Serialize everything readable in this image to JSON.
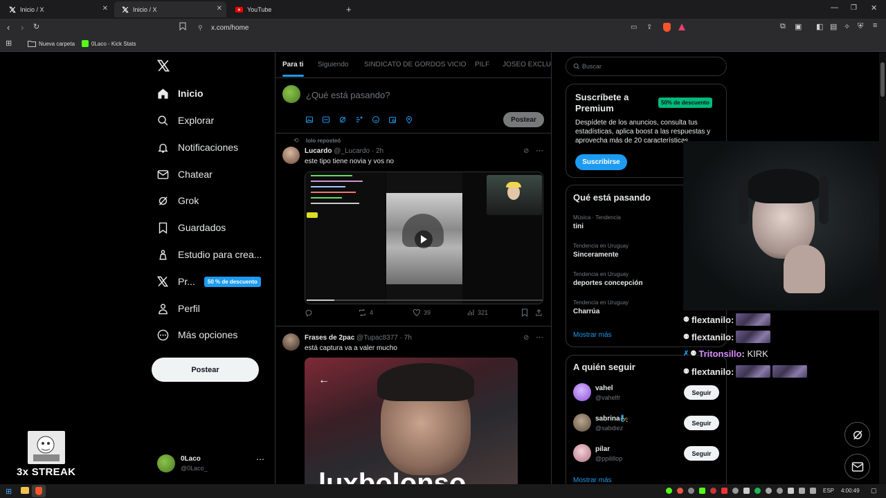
{
  "browser": {
    "tabs": [
      {
        "title": "Inicio / X"
      },
      {
        "title": "Inicio / X"
      },
      {
        "title": "YouTube"
      }
    ],
    "url": "x.com/home",
    "bookmarks": [
      {
        "label": "Nueva carpeta",
        "icon": "folder-icon"
      },
      {
        "label": "0Laco - Kick Stats",
        "icon": "kick-icon"
      }
    ]
  },
  "sidebar": {
    "nav": [
      {
        "label": "Inicio",
        "icon": "home-icon",
        "active": true
      },
      {
        "label": "Explorar",
        "icon": "search-icon"
      },
      {
        "label": "Notificaciones",
        "icon": "bell-icon"
      },
      {
        "label": "Chatear",
        "icon": "mail-icon"
      },
      {
        "label": "Grok",
        "icon": "grok-icon"
      },
      {
        "label": "Guardados",
        "icon": "bookmark-icon"
      },
      {
        "label": "Estudio para crea...",
        "icon": "studio-icon"
      },
      {
        "label": "Pr...",
        "icon": "x-premium-icon",
        "badge": "50 % de descuento"
      },
      {
        "label": "Perfil",
        "icon": "person-icon"
      },
      {
        "label": "Más opciones",
        "icon": "more-circle-icon"
      }
    ],
    "post_button": "Postear",
    "account": {
      "name": "0Laco",
      "handle": "@0Laco_"
    }
  },
  "feed": {
    "tabs": [
      "Para ti",
      "Siguiendo",
      "SINDICATO DE GORDOS VICIO",
      "PILF",
      "JOSEO EXCLUSI"
    ],
    "composer": {
      "placeholder": "¿Qué está pasando?",
      "post_button": "Postear"
    },
    "posts": [
      {
        "repost_note": "lolo reposteó",
        "author": "Lucardo",
        "handle": "@_Lucardo",
        "time": "2h",
        "text": "este tipo tiene novia y vos no",
        "replies": "",
        "reposts": "4",
        "likes": "39",
        "views": "321"
      },
      {
        "author": "Frases de 2pac",
        "handle": "@Tupac8377",
        "time": "7h",
        "text": "está captura va a valer mucho",
        "image_caption": "luxbolonso"
      }
    ]
  },
  "right": {
    "search_placeholder": "Buscar",
    "premium": {
      "title": "Suscríbete a Premium",
      "badge": "50% de descuento",
      "text": "Despídete de los anuncios, consulta tus estadísticas, aplica boost a las respuestas y aprovecha más de 20 características",
      "button": "Suscribirse"
    },
    "trends": {
      "title": "Qué está pasando",
      "items": [
        {
          "context": "Música · Tendencia",
          "name": "tini"
        },
        {
          "context": "Tendencia en Uruguay",
          "name": "Sinceramente"
        },
        {
          "context": "Tendencia en Uruguay",
          "name": "deportes concepción"
        },
        {
          "context": "Tendencia en Uruguay",
          "name": "Charrúa"
        }
      ],
      "more": "Mostrar más"
    },
    "follow": {
      "title": "A quién seguir",
      "items": [
        {
          "name": "vahel",
          "handle": "@vahelfr",
          "button": "Seguir"
        },
        {
          "name": "sabrina🧞",
          "handle": "@sabdiez",
          "button": "Seguir"
        },
        {
          "name": "pilar",
          "handle": "@ppilillop",
          "button": "Seguir"
        }
      ],
      "more": "Mostrar más"
    }
  },
  "overlay": {
    "chat": [
      {
        "user": "flextanilo",
        "msg": ""
      },
      {
        "user": "flextanilo",
        "msg": ""
      },
      {
        "user": "Tritonsillo",
        "msg": "KIRK"
      },
      {
        "user": "flextanilo",
        "msg": ""
      }
    ],
    "streak": "3x STREAK"
  },
  "taskbar": {
    "lang": "ESP",
    "time": "4:00:49"
  },
  "colors": {
    "accent": "#1d9bf0",
    "bg": "#000000",
    "border": "#2f3336",
    "green": "#00ba7c"
  }
}
